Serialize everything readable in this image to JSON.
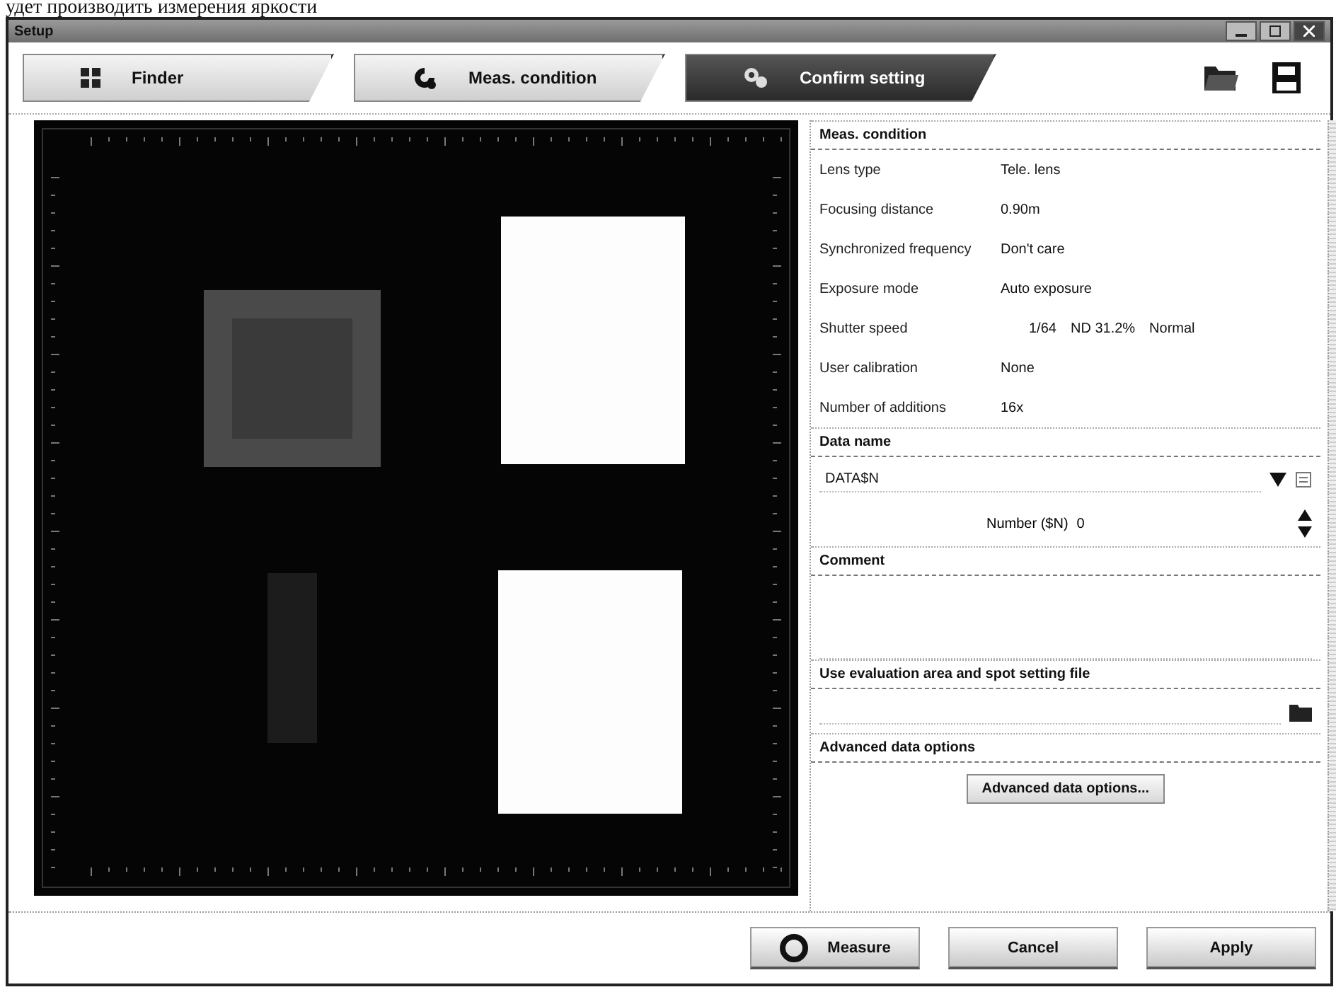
{
  "document_text": "удет производить измерения яркости",
  "window": {
    "title": "Setup"
  },
  "tabs": [
    {
      "label": "Finder",
      "selected": false
    },
    {
      "label": "Meas. condition",
      "selected": false
    },
    {
      "label": "Confirm setting",
      "selected": true
    }
  ],
  "meas_condition": {
    "title": "Meas. condition",
    "rows": [
      {
        "label": "Lens type",
        "values": [
          "Tele. lens"
        ]
      },
      {
        "label": "Focusing distance",
        "values": [
          "0.90m"
        ]
      },
      {
        "label": "Synchronized frequency",
        "values": [
          "Don't care"
        ]
      },
      {
        "label": "Exposure mode",
        "values": [
          "Auto exposure"
        ]
      },
      {
        "label": "Shutter speed",
        "values": [
          "1/64",
          "ND 31.2%",
          "Normal"
        ]
      },
      {
        "label": "User calibration",
        "values": [
          "None"
        ]
      },
      {
        "label": "Number of additions",
        "values": [
          "16x"
        ]
      }
    ]
  },
  "data_name": {
    "title": "Data name",
    "value": "DATA$N",
    "number_label": "Number ($N)",
    "number_value": "0"
  },
  "comment": {
    "title": "Comment"
  },
  "evaluation_file": {
    "title": "Use evaluation area and spot setting file"
  },
  "advanced": {
    "title": "Advanced data options",
    "button": "Advanced data options..."
  },
  "buttons": [
    {
      "label": "Measure",
      "kind": "measure"
    },
    {
      "label": "Cancel",
      "kind": "plain"
    },
    {
      "label": "Apply",
      "kind": "plain"
    }
  ]
}
